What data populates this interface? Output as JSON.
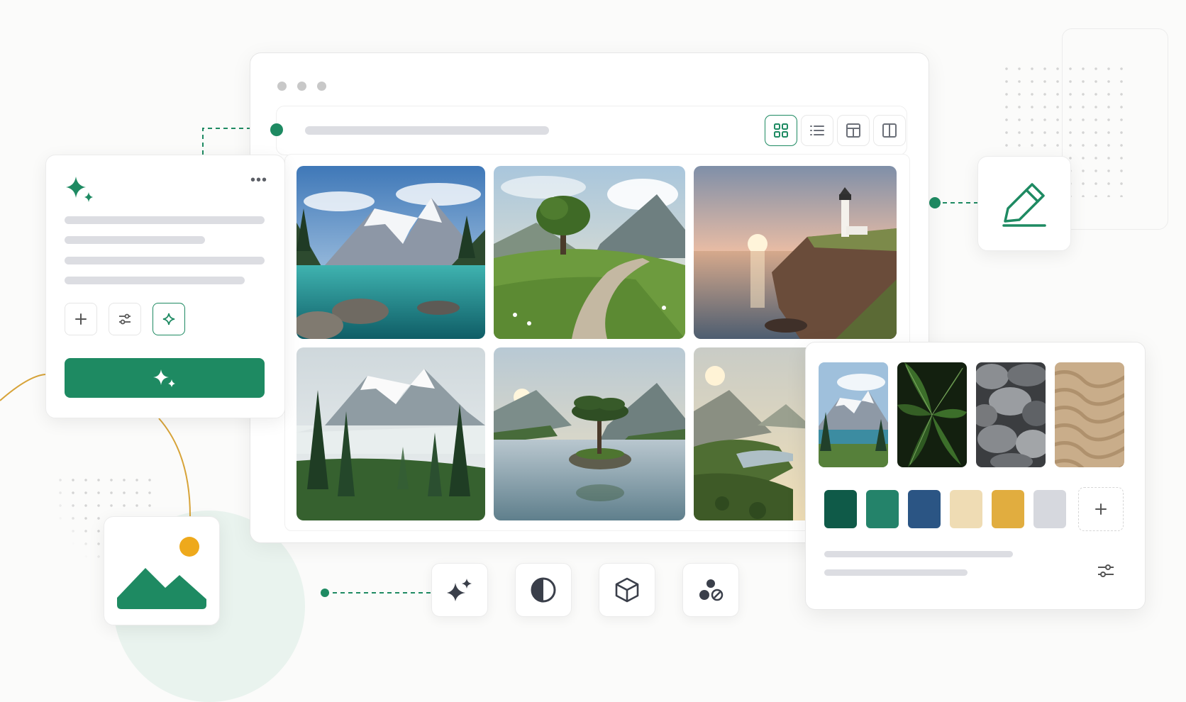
{
  "window": {
    "view_modes": [
      "grid-view",
      "list-view",
      "table-view",
      "split-view"
    ],
    "active_view": "grid-view"
  },
  "gallery": {
    "images": [
      {
        "name": "mountain-lake-image"
      },
      {
        "name": "tree-path-image"
      },
      {
        "name": "lighthouse-sunset-image"
      },
      {
        "name": "misty-forest-image"
      },
      {
        "name": "island-tree-lake-image"
      },
      {
        "name": "mountain-valley-river-image"
      }
    ]
  },
  "prompt_panel": {
    "icons": [
      "sparkle-icon",
      "more-icon",
      "plus-icon",
      "sliders-icon",
      "sparkle-icon"
    ],
    "generate_button_icon": "sparkle-icon"
  },
  "tools": [
    "magic-sparkle-icon",
    "contrast-icon",
    "cube-icon",
    "blend-icon"
  ],
  "style_panel": {
    "references": [
      "mountain-reference",
      "leaf-reference",
      "stones-reference",
      "sand-reference"
    ],
    "palette": [
      "#0f5a48",
      "#24836a",
      "#2b5584",
      "#efdcb4",
      "#e1ad3f",
      "#d6d8de"
    ]
  },
  "colors": {
    "accent": "#1e8a62",
    "connector_gold": "#d7a338",
    "sun": "#eea91c"
  }
}
